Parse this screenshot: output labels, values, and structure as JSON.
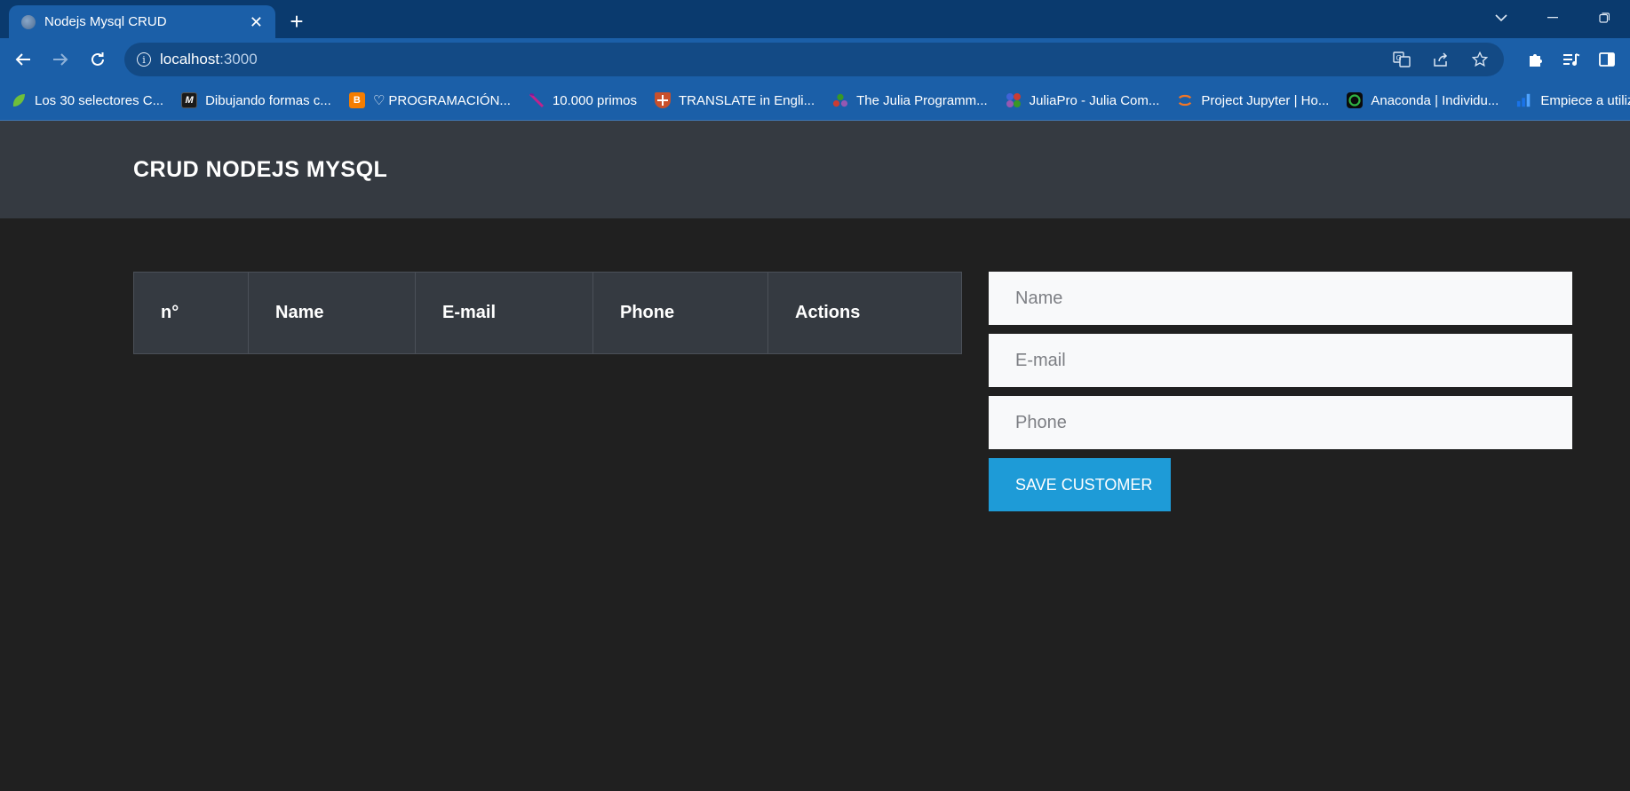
{
  "browser": {
    "tab_title": "Nodejs Mysql CRUD",
    "new_tab_label": "+",
    "url_host": "localhost",
    "url_port": ":3000",
    "bookmarks": [
      {
        "label": "Los 30 selectores C...",
        "icon": "leaf-icon",
        "color": "#6fbf3b"
      },
      {
        "label": "Dibujando formas c...",
        "icon": "m-logo-icon",
        "color": "#1a1a1a"
      },
      {
        "label": "♡ PROGRAMACIÓN...",
        "icon": "blogger-icon",
        "color": "#f57d00"
      },
      {
        "label": "10.000 primos",
        "icon": "feather-icon",
        "color": "#8a1a8a"
      },
      {
        "label": "TRANSLATE in Engli...",
        "icon": "cambridge-shield-icon",
        "color": "#c8502c"
      },
      {
        "label": "The Julia Programm...",
        "icon": "julia-dots-icon",
        "color": "#9558b2"
      },
      {
        "label": "JuliaPro - Julia Com...",
        "icon": "juliapro-icon",
        "color": "#4063d8"
      },
      {
        "label": "Project Jupyter | Ho...",
        "icon": "jupyter-icon",
        "color": "#f37626"
      },
      {
        "label": "Anaconda | Individu...",
        "icon": "anaconda-icon",
        "color": "#2fb344"
      },
      {
        "label": "Empiece a utilizar",
        "icon": "bars-icon",
        "color": "#1a73e8"
      }
    ]
  },
  "navbar": {
    "brand": "CRUD NODEJS MYSQL"
  },
  "table": {
    "columns": [
      "n°",
      "Name",
      "E-mail",
      "Phone",
      "Actions"
    ]
  },
  "form": {
    "name_placeholder": "Name",
    "email_placeholder": "E-mail",
    "phone_placeholder": "Phone",
    "save_label": "SAVE CUSTOMER"
  },
  "colors": {
    "page_bg": "#202020",
    "navbar_bg": "#353a41",
    "button_primary": "#1e9bd7",
    "chrome_blue": "#1b5fa8"
  }
}
